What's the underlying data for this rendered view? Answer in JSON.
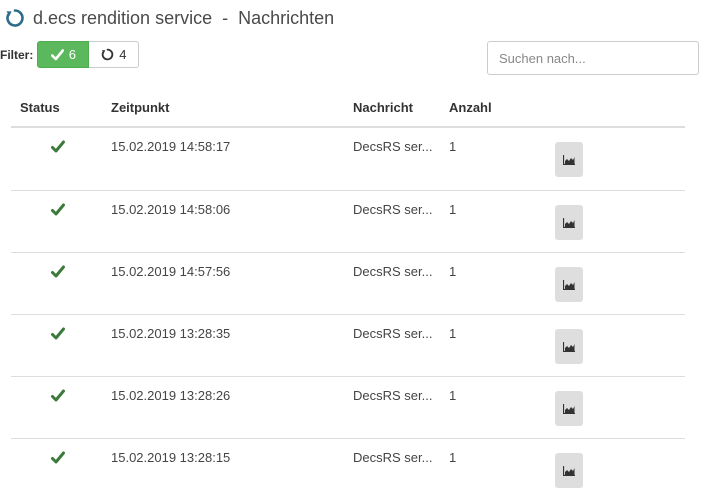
{
  "header": {
    "title": "d.ecs rendition service  -  Nachrichten",
    "icon": "refresh-icon"
  },
  "filter": {
    "label": "Filter:",
    "ok_count": "6",
    "pending_count": "4",
    "ok_icon": "check-icon",
    "pending_icon": "refresh-icon",
    "ok_color": "#5cb85c"
  },
  "search": {
    "placeholder": "Suchen nach...",
    "value": ""
  },
  "table": {
    "columns": [
      "Status",
      "Zeitpunkt",
      "Nachricht",
      "Anzahl"
    ],
    "rows": [
      {
        "status": "check-icon",
        "time": "15.02.2019 14:58:17",
        "message": "DecsRS ser...",
        "count": "1",
        "action": "chart-icon"
      },
      {
        "status": "check-icon",
        "time": "15.02.2019 14:58:06",
        "message": "DecsRS ser...",
        "count": "1",
        "action": "chart-icon"
      },
      {
        "status": "check-icon",
        "time": "15.02.2019 14:57:56",
        "message": "DecsRS ser...",
        "count": "1",
        "action": "chart-icon"
      },
      {
        "status": "check-icon",
        "time": "15.02.2019 13:28:35",
        "message": "DecsRS ser...",
        "count": "1",
        "action": "chart-icon"
      },
      {
        "status": "check-icon",
        "time": "15.02.2019 13:28:26",
        "message": "DecsRS ser...",
        "count": "1",
        "action": "chart-icon"
      },
      {
        "status": "check-icon",
        "time": "15.02.2019 13:28:15",
        "message": "DecsRS ser...",
        "count": "1",
        "action": "chart-icon"
      }
    ]
  },
  "colors": {
    "status_ok": "#3c7a3c",
    "header_icon": "#2d6d8a"
  }
}
